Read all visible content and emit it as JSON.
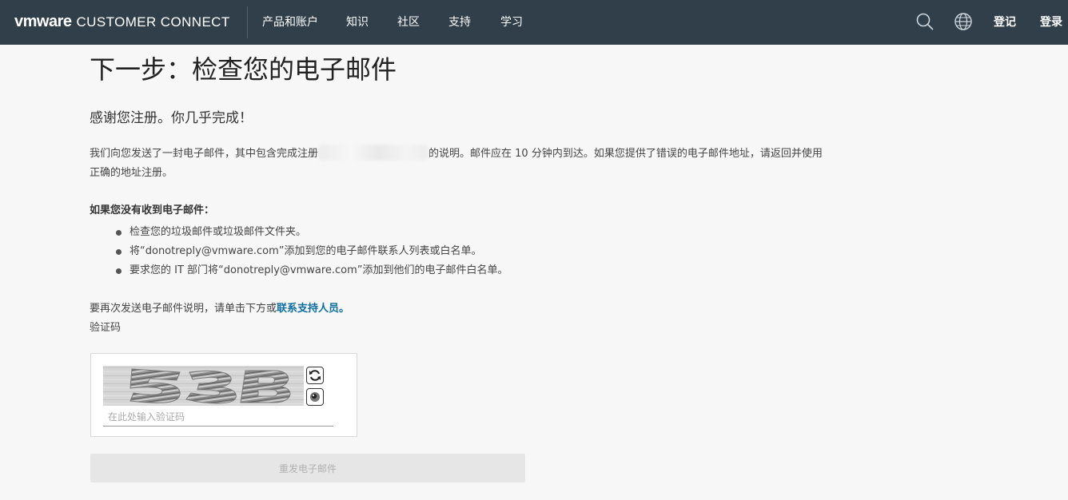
{
  "header": {
    "brand_logo": "vmware",
    "brand_name": "CUSTOMER CONNECT",
    "nav": [
      "产品和账户",
      "知识",
      "社区",
      "支持",
      "学习"
    ],
    "icons": [
      "search-icon",
      "globe-icon"
    ],
    "register_label": "登记",
    "login_label": "登录",
    "background": "#313f4b"
  },
  "main": {
    "title": "下一步：检查您的电子邮件",
    "subtitle": "感谢您注册。你几乎完成！",
    "desc_part1": "我们向您发送了一封电子邮件，其中包含完成注册",
    "desc_part2": "的说明。邮件应在 10 分钟内到达。如果您提供了错误的电子邮件地址，请返回并使用正确的地址注册。",
    "not_received_heading": "如果您没有收到电子邮件：",
    "tips": [
      "检查您的垃圾邮件或垃圾邮件文件夹。",
      "将“donotreply@vmware.com”添加到您的电子邮件联系人列表或白名单。",
      "要求您的 IT 部门将“donotreply@vmware.com”添加到他们的电子邮件白名单。"
    ],
    "resend_note_prefix": "要再次发送电子邮件说明，请单击下方或",
    "support_link": "联系支持人员。",
    "captcha_label": "验证码",
    "captcha_placeholder": "在此处输入验证码",
    "captcha_value": "",
    "resend_button": "重发电子邮件",
    "link_color": "#0f6ea0"
  }
}
